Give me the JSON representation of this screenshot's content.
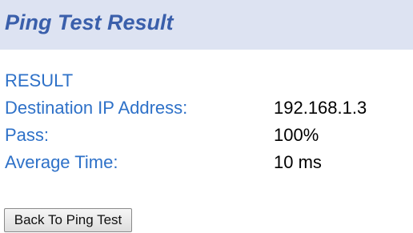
{
  "header": {
    "title": "Ping Test Result"
  },
  "result": {
    "heading": "RESULT",
    "rows": [
      {
        "label": "Destination IP Address:",
        "value": "192.168.1.3"
      },
      {
        "label": "Pass:",
        "value": "100%"
      },
      {
        "label": "Average Time:",
        "value": "10 ms"
      }
    ]
  },
  "actions": {
    "back_label": "Back To Ping Test"
  },
  "colors": {
    "title_bar_bg": "#dde3f2",
    "title_text": "#3a5fab",
    "label_text": "#2e71c8",
    "value_text": "#000000"
  }
}
